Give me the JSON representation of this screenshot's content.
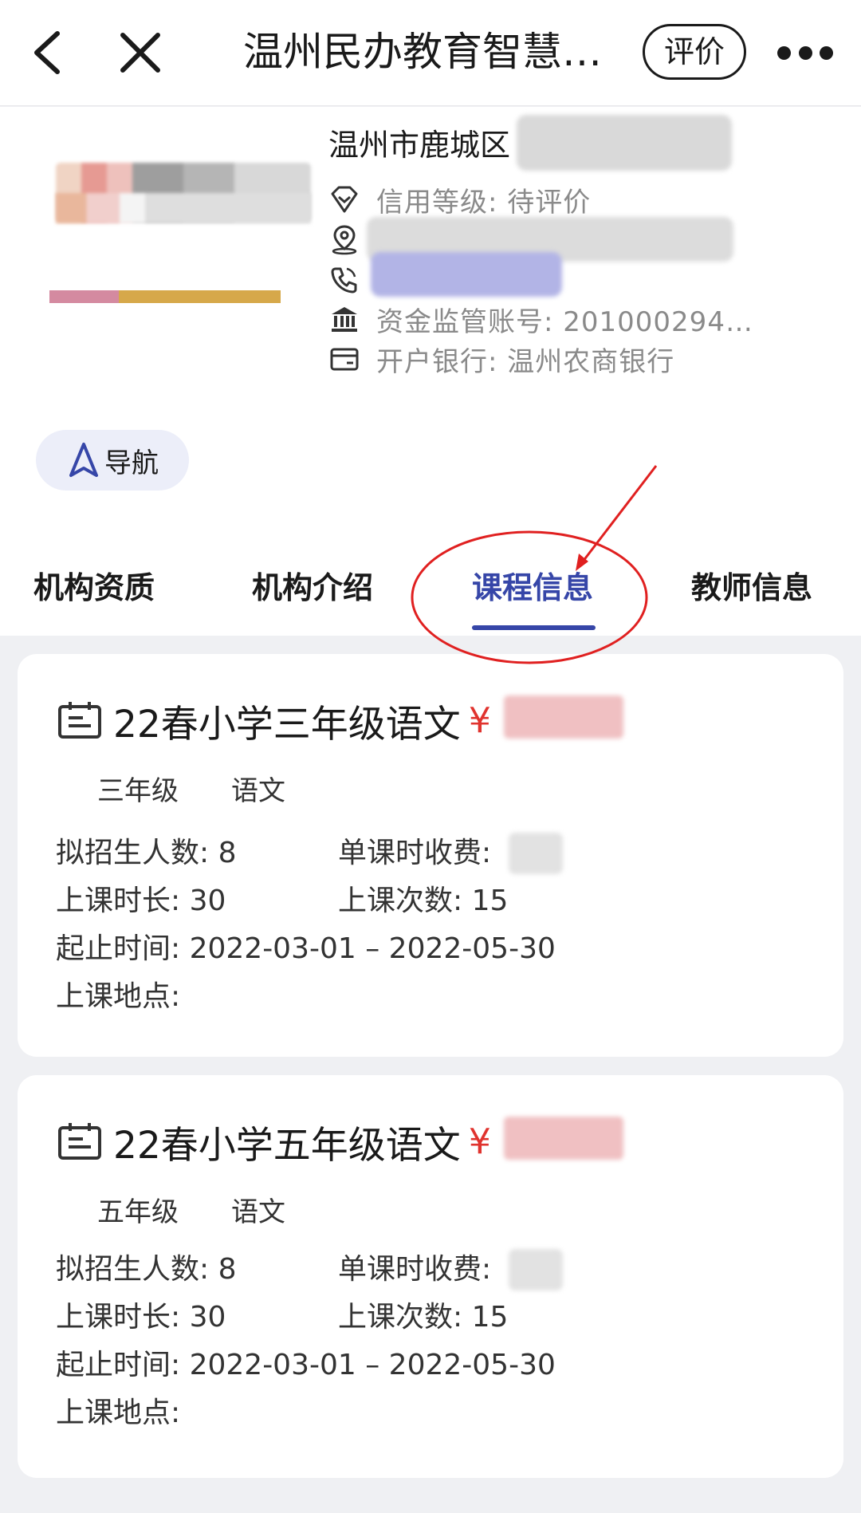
{
  "navbar": {
    "title": "温州民办教育智慧…",
    "rate_label": "评价"
  },
  "header": {
    "org_name": "温州市鹿城区",
    "credit": "信用等级:  待评价",
    "fund_account": "资金监管账号:  201000294…",
    "bank": "开户银行:  温州农商银行",
    "nav_label": "导航"
  },
  "tabs": [
    {
      "label": "机构资质"
    },
    {
      "label": "机构介绍"
    },
    {
      "label": "课程信息"
    },
    {
      "label": "教师信息"
    }
  ],
  "courses": [
    {
      "title": "22春小学三年级语文",
      "currency": "¥",
      "tags": [
        "三年级",
        "语文"
      ],
      "enroll": "拟招生人数:  8",
      "fee_label": "单课时收费:",
      "duration": "上课时长:  30",
      "times": "上课次数:  15",
      "period": "起止时间:   2022-03-01 – 2022-05-30",
      "location": "上课地点:"
    },
    {
      "title": "22春小学五年级语文",
      "currency": "¥",
      "tags": [
        "五年级",
        "语文"
      ],
      "enroll": "拟招生人数:  8",
      "fee_label": "单课时收费:",
      "duration": "上课时长:  30",
      "times": "上课次数:  15",
      "period": "起止时间:   2022-03-01 – 2022-05-30",
      "location": "上课地点:"
    }
  ],
  "colors": {
    "accent": "#3646a8",
    "price": "#e0332e",
    "annotation": "#e02020"
  }
}
